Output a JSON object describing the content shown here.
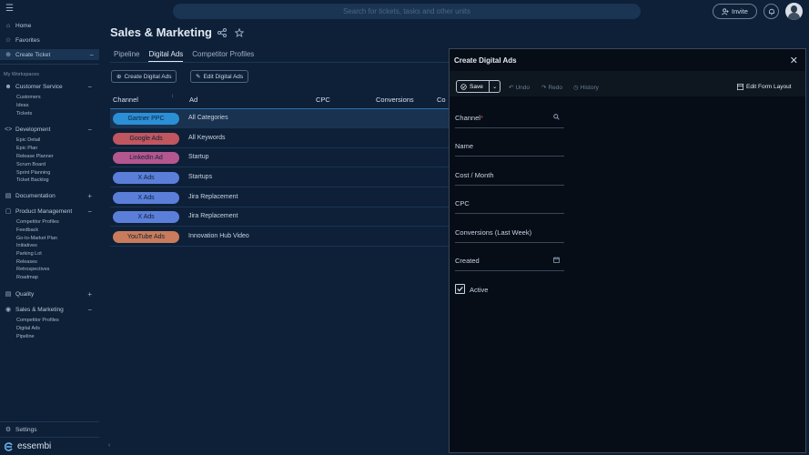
{
  "topbar": {
    "search_placeholder": "Search for tickets, tasks and other units",
    "invite_label": "Invite"
  },
  "sidebar": {
    "top_items": [
      {
        "label": "Home",
        "icon": "home-icon"
      },
      {
        "label": "Favorites",
        "icon": "star-icon"
      },
      {
        "label": "Create Ticket",
        "icon": "plus-circle-icon"
      }
    ],
    "workspaces_heading": "My Workspaces",
    "groups": [
      {
        "label": "Customer Service",
        "icon": "users-icon",
        "toggle": "−",
        "children": [
          "Customers",
          "Ideas",
          "Tickets"
        ]
      },
      {
        "label": "Development",
        "icon": "code-icon",
        "toggle": "−",
        "children": [
          "Epic Detail",
          "Epic Plan",
          "Release Planner",
          "Scrum Board",
          "Sprint Planning",
          "Ticket Backlog"
        ]
      },
      {
        "label": "Documentation",
        "icon": "document-icon",
        "toggle": "+",
        "children": []
      },
      {
        "label": "Product Management",
        "icon": "box-icon",
        "toggle": "−",
        "children": [
          "Competitor Profiles",
          "Feedback",
          "Go-to-Market Plan",
          "Initiatives",
          "Parking Lot",
          "Releases",
          "Retrospectives",
          "Roadmap"
        ]
      },
      {
        "label": "Quality",
        "icon": "quality-icon",
        "toggle": "+",
        "children": []
      },
      {
        "label": "Sales & Marketing",
        "icon": "target-icon",
        "toggle": "−",
        "children": [
          "Competitor Profiles",
          "Digital Ads",
          "Pipeline"
        ]
      }
    ],
    "settings_label": "Settings",
    "brand": "essembi"
  },
  "main": {
    "title": "Sales & Marketing",
    "tabs": [
      "Pipeline",
      "Digital Ads",
      "Competitor Profiles"
    ],
    "active_tab": "Digital Ads",
    "create_button": "Create Digital Ads",
    "edit_button": "Edit Digital Ads",
    "columns": [
      "Channel",
      "Ad",
      "CPC",
      "Conversions",
      "Co"
    ],
    "rows": [
      {
        "channel": "Gartner PPC",
        "ad": "All Categories",
        "color": "#2b8fd6"
      },
      {
        "channel": "Google Ads",
        "ad": "All Keywords",
        "color": "#c0565f"
      },
      {
        "channel": "LinkedIn Ad",
        "ad": "Startup",
        "color": "#b5578f"
      },
      {
        "channel": "X Ads",
        "ad": "Startups",
        "color": "#5b7fd9"
      },
      {
        "channel": "X Ads",
        "ad": "Jira Replacement",
        "color": "#5b7fd9"
      },
      {
        "channel": "X Ads",
        "ad": "Jira Replacement",
        "color": "#5b7fd9"
      },
      {
        "channel": "YouTube Ads",
        "ad": "Innovation Hub Video",
        "color": "#c97b5b"
      }
    ]
  },
  "panel": {
    "title": "Create Digital Ads",
    "save_label": "Save",
    "undo_label": "Undo",
    "redo_label": "Redo",
    "history_label": "History",
    "edit_layout_label": "Edit Form Layout",
    "fields": [
      {
        "label": "Channel",
        "required": "*"
      },
      {
        "label": "Name"
      },
      {
        "label": "Cost / Month"
      },
      {
        "label": "CPC"
      },
      {
        "label": "Conversions (Last Week)"
      },
      {
        "label": "Created"
      }
    ],
    "active_label": "Active",
    "active_checked": true
  }
}
